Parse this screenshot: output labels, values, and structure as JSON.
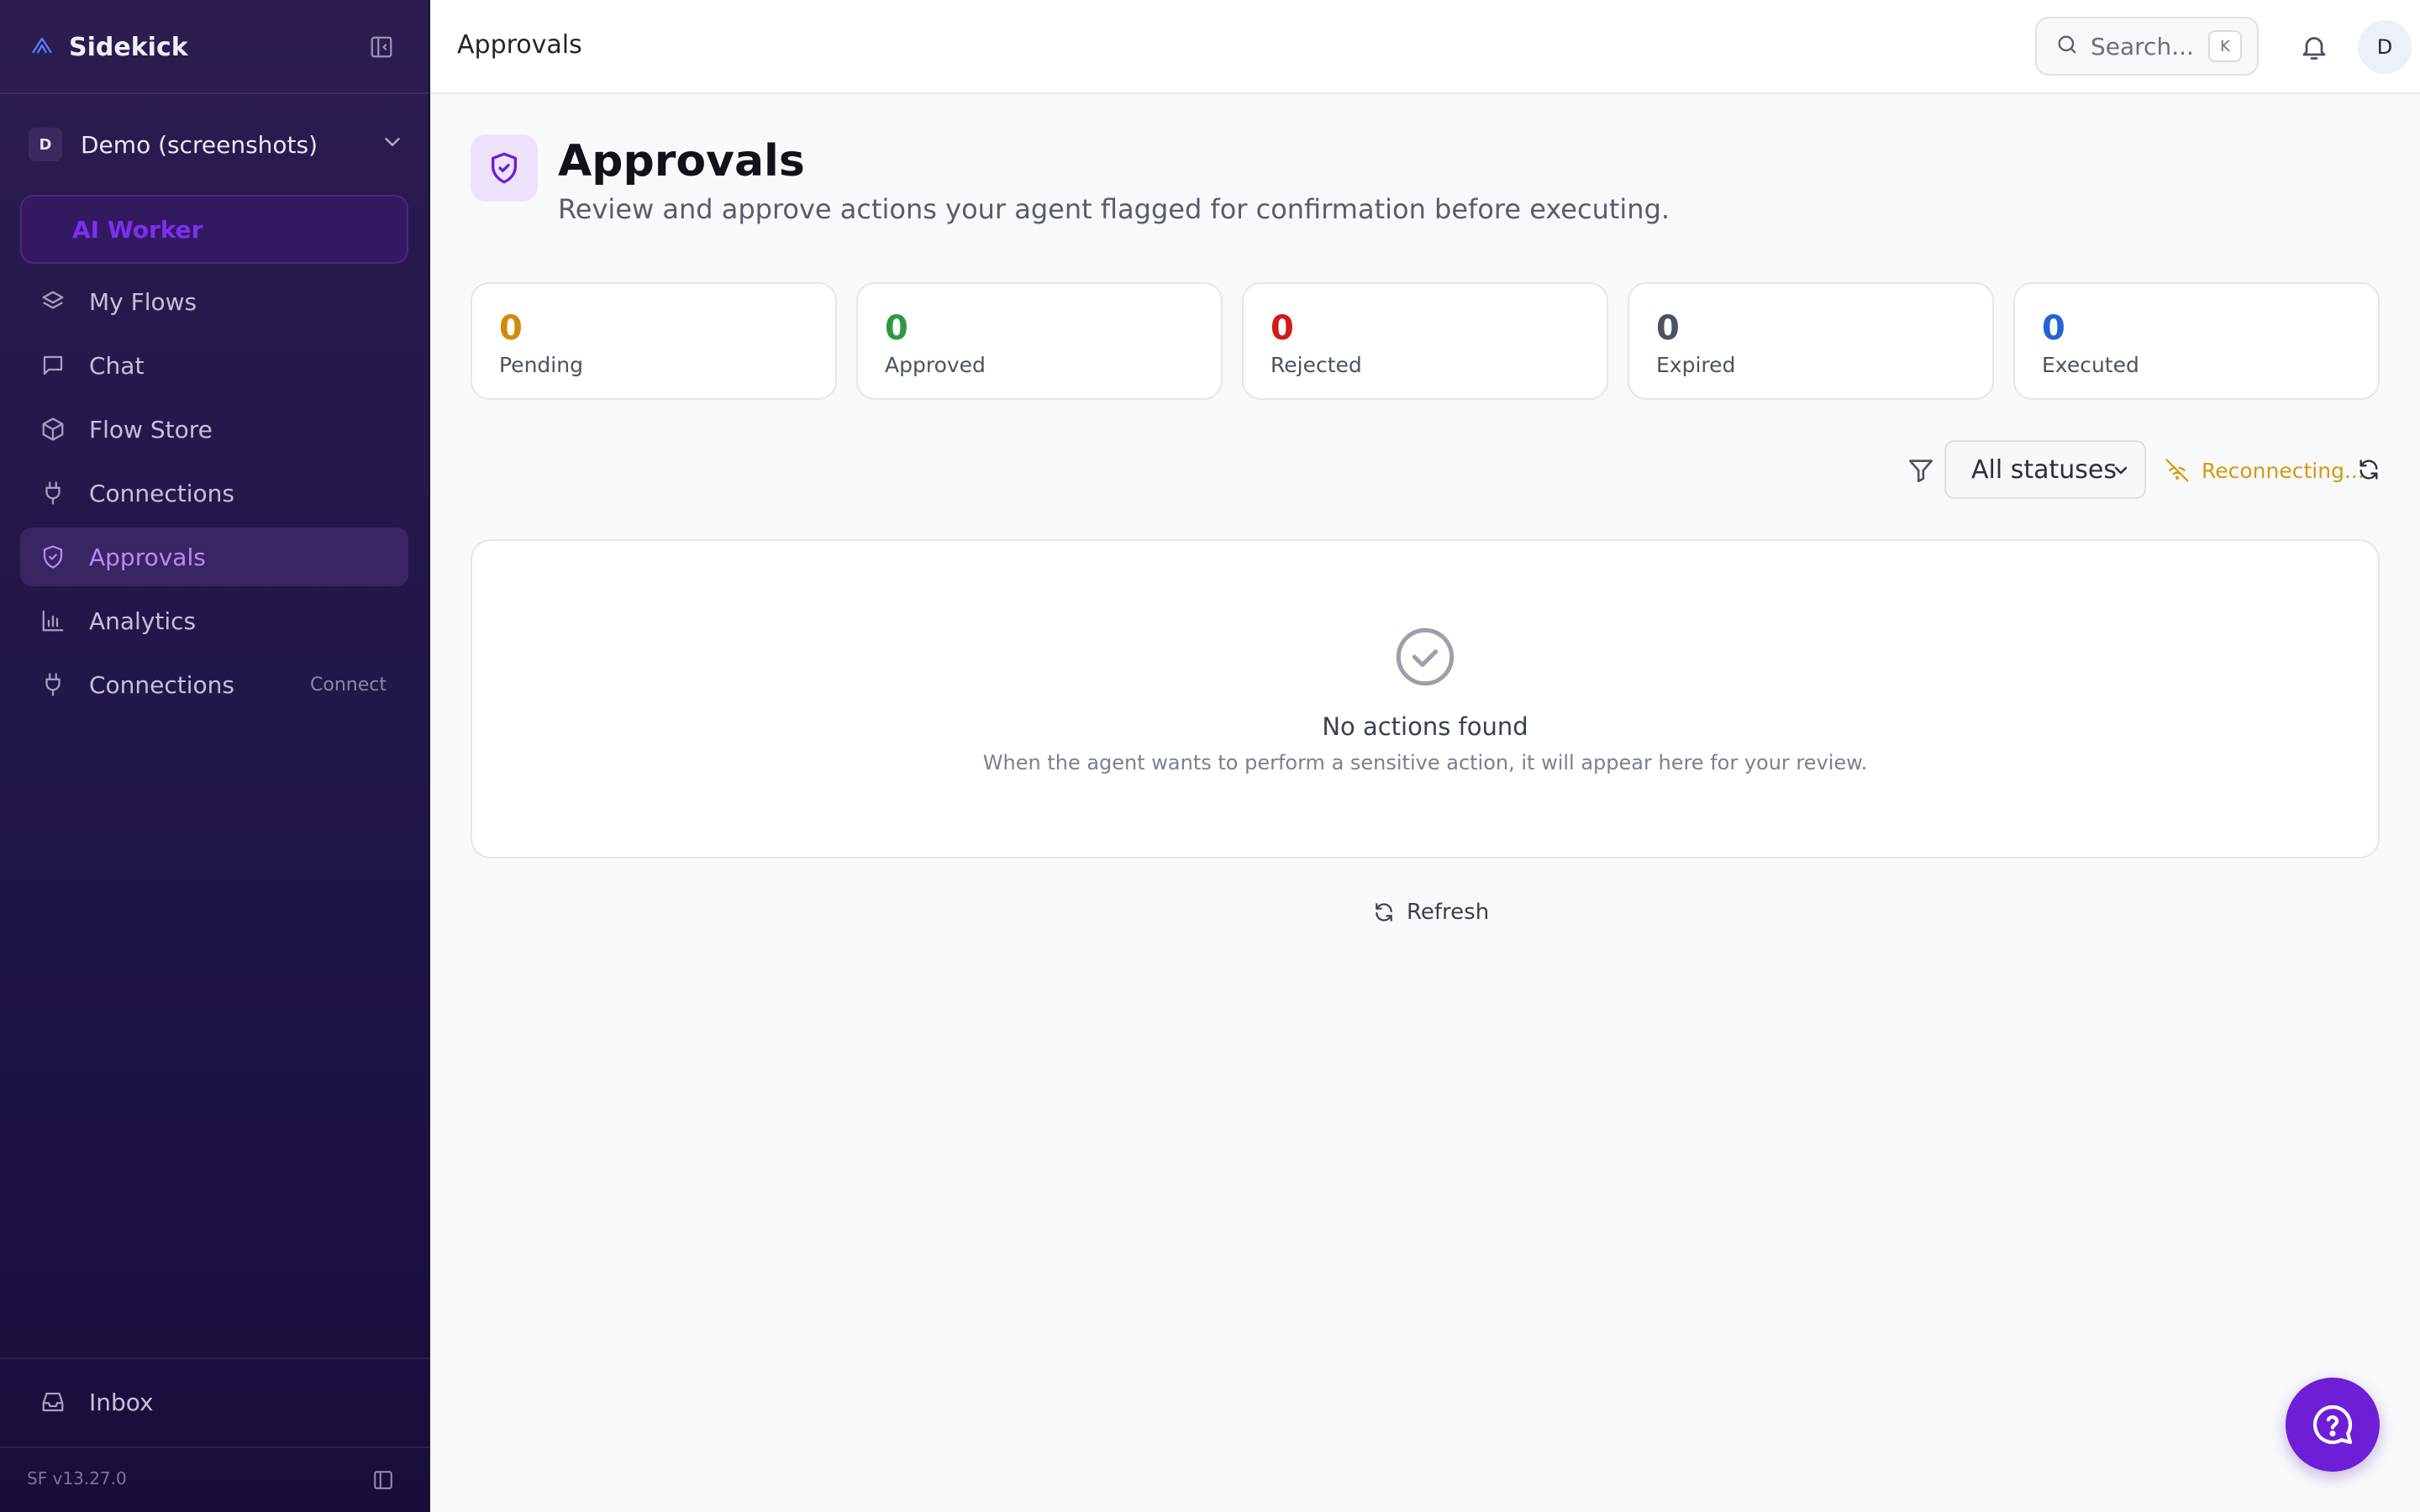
{
  "sidebar": {
    "brand": "Sidekick",
    "workspace": {
      "badge": "D",
      "name": "Demo (screenshots)"
    },
    "ai_worker": "AI Worker",
    "items": [
      {
        "label": "My Flows",
        "icon": "layers-icon"
      },
      {
        "label": "Chat",
        "icon": "message-square-icon"
      },
      {
        "label": "Flow Store",
        "icon": "package-icon"
      },
      {
        "label": "Connections",
        "icon": "plug-icon"
      },
      {
        "label": "Approvals",
        "icon": "shield-check-icon",
        "active": true
      },
      {
        "label": "Analytics",
        "icon": "bar-chart-icon"
      },
      {
        "label": "Connections",
        "icon": "plug-icon",
        "hint": "Connect"
      }
    ],
    "inbox": "Inbox",
    "version": "SF v13.27.0"
  },
  "header": {
    "title": "Approvals",
    "search_placeholder": "Search...",
    "search_shortcut": "K",
    "avatar": "D"
  },
  "page": {
    "title": "Approvals",
    "subtitle": "Review and approve actions your agent flagged for confirmation before executing."
  },
  "stats": [
    {
      "value": "0",
      "label": "Pending",
      "color": "#d38a0b"
    },
    {
      "value": "0",
      "label": "Approved",
      "color": "#2e9a3e"
    },
    {
      "value": "0",
      "label": "Rejected",
      "color": "#d21a1a"
    },
    {
      "value": "0",
      "label": "Expired",
      "color": "#4b5262"
    },
    {
      "value": "0",
      "label": "Executed",
      "color": "#2463d3"
    }
  ],
  "filter": {
    "selected": "All statuses",
    "connection_status": "Reconnecting..."
  },
  "empty": {
    "title": "No actions found",
    "description": "When the agent wants to perform a sensitive action, it will appear here for your review."
  },
  "refresh_label": "Refresh",
  "colors": {
    "accent": "#6d1ed6",
    "active_nav_text": "#b78bf5",
    "warning": "#d39a10"
  }
}
